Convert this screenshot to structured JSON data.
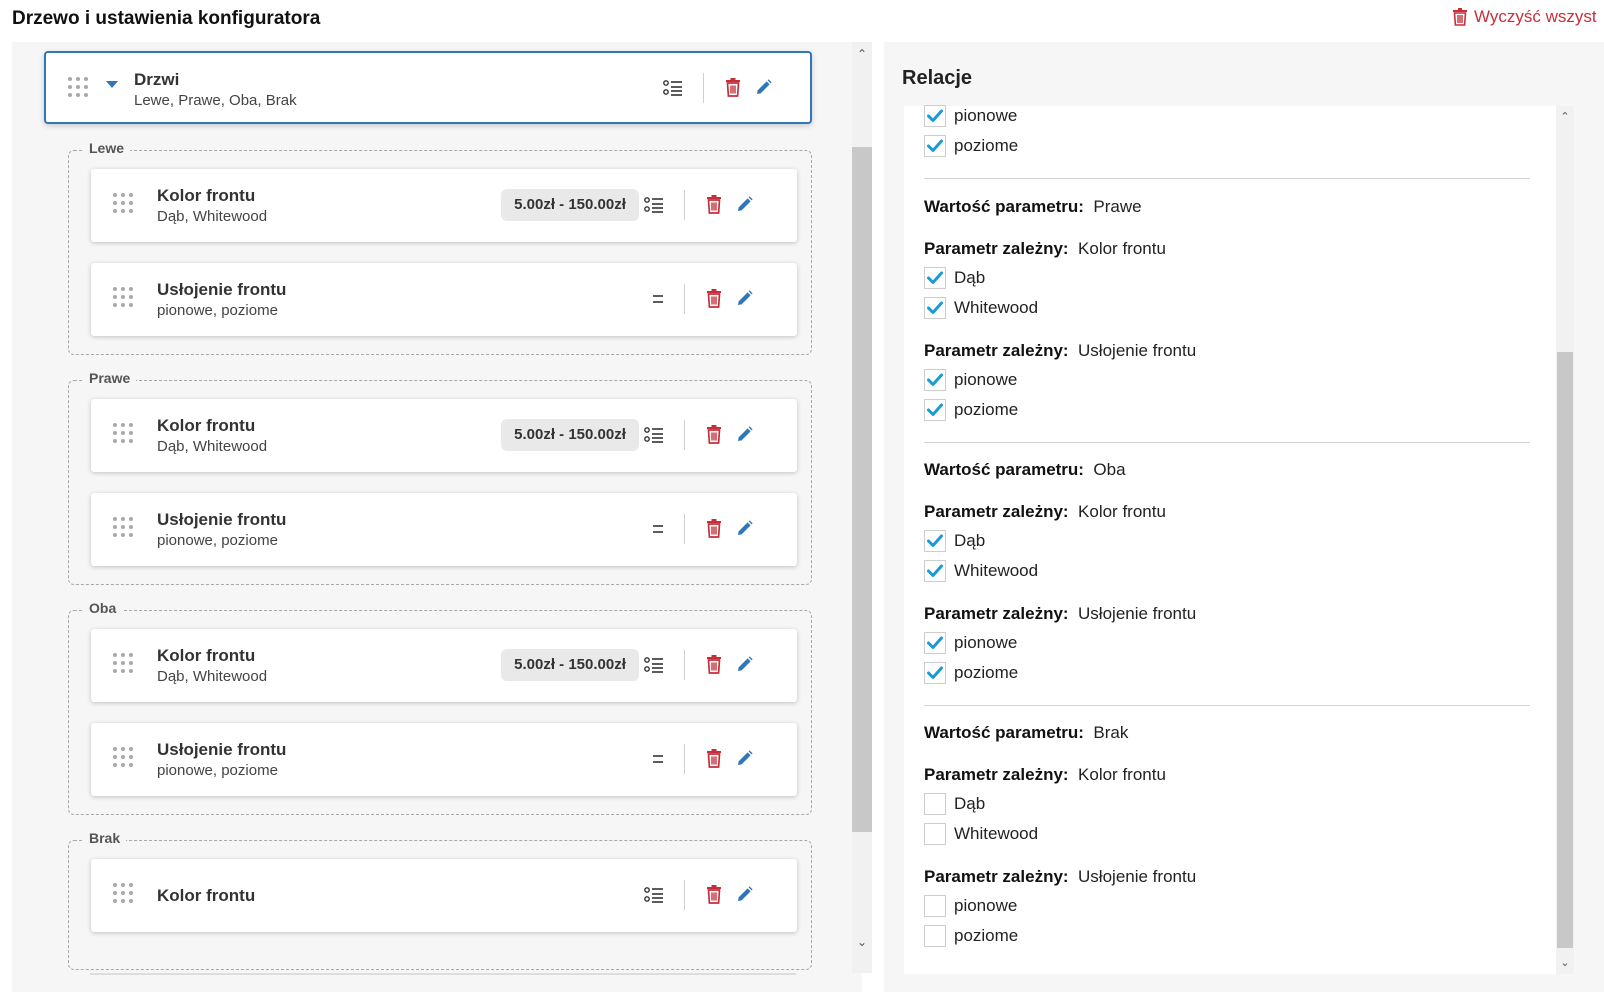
{
  "header": {
    "title": "Drzewo i ustawienia konfiguratora",
    "clear_label": "Wyczyść wszyst"
  },
  "colors": {
    "accent": "#2f77b9",
    "danger": "#c62f3a",
    "check": "#1a9ad6"
  },
  "tree": {
    "root": {
      "title": "Drzwi",
      "subtitle": "Lewe, Prawe, Oba, Brak"
    },
    "groups": [
      {
        "label": "Lewe",
        "cards": [
          {
            "title": "Kolor frontu",
            "subtitle": "Dąb, Whitewood",
            "price": "5.00zł - 150.00zł"
          },
          {
            "title": "Usłojenie frontu",
            "subtitle": "pionowe, poziome"
          }
        ]
      },
      {
        "label": "Prawe",
        "cards": [
          {
            "title": "Kolor frontu",
            "subtitle": "Dąb, Whitewood",
            "price": "5.00zł - 150.00zł"
          },
          {
            "title": "Usłojenie frontu",
            "subtitle": "pionowe, poziome"
          }
        ]
      },
      {
        "label": "Oba",
        "cards": [
          {
            "title": "Kolor frontu",
            "subtitle": "Dąb, Whitewood",
            "price": "5.00zł - 150.00zł"
          },
          {
            "title": "Usłojenie frontu",
            "subtitle": "pionowe, poziome"
          }
        ]
      },
      {
        "label": "Brak",
        "cards": [
          {
            "title": "Kolor frontu"
          }
        ]
      }
    ]
  },
  "relations": {
    "title": "Relacje",
    "value_label": "Wartość parametru:",
    "dep_label": "Parametr zależny:",
    "top_items": [
      {
        "label": "pionowe",
        "checked": true
      },
      {
        "label": "poziome",
        "checked": true
      }
    ],
    "sections": [
      {
        "value": "Prawe",
        "deps": [
          {
            "name": "Kolor frontu",
            "items": [
              {
                "label": "Dąb",
                "checked": true
              },
              {
                "label": "Whitewood",
                "checked": true
              }
            ]
          },
          {
            "name": "Usłojenie frontu",
            "items": [
              {
                "label": "pionowe",
                "checked": true
              },
              {
                "label": "poziome",
                "checked": true
              }
            ]
          }
        ]
      },
      {
        "value": "Oba",
        "deps": [
          {
            "name": "Kolor frontu",
            "items": [
              {
                "label": "Dąb",
                "checked": true
              },
              {
                "label": "Whitewood",
                "checked": true
              }
            ]
          },
          {
            "name": "Usłojenie frontu",
            "items": [
              {
                "label": "pionowe",
                "checked": true
              },
              {
                "label": "poziome",
                "checked": true
              }
            ]
          }
        ]
      },
      {
        "value": "Brak",
        "deps": [
          {
            "name": "Kolor frontu",
            "items": [
              {
                "label": "Dąb",
                "checked": false
              },
              {
                "label": "Whitewood",
                "checked": false
              }
            ]
          },
          {
            "name": "Usłojenie frontu",
            "items": [
              {
                "label": "pionowe",
                "checked": false
              },
              {
                "label": "poziome",
                "checked": false
              }
            ]
          }
        ]
      }
    ]
  }
}
